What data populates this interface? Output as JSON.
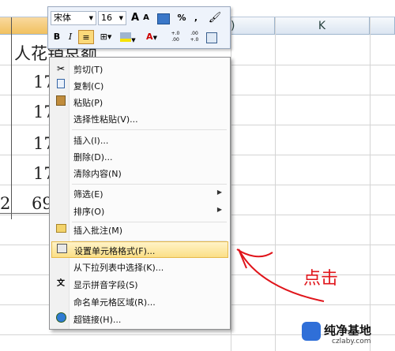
{
  "sheet": {
    "col_header_k": "K",
    "col_header_j_fragment": ")",
    "header_text": "人花销总额",
    "values": [
      "17",
      "17",
      "17",
      "17",
      "69"
    ],
    "row_fragment": "2"
  },
  "mini_toolbar": {
    "font_name": "宋体",
    "font_size": "16",
    "grow_font": "A",
    "shrink_font": "A",
    "percent": "%",
    "comma": ",",
    "bold": "B",
    "italic": "I",
    "font_color_letter": "A",
    "inc_decimal": "+.0 .00",
    "dec_decimal": ".00 +.0"
  },
  "context_menu": {
    "items": [
      {
        "label": "剪切(T)",
        "icon": "scissors-icon"
      },
      {
        "label": "复制(C)",
        "icon": "copy-icon"
      },
      {
        "label": "粘贴(P)",
        "icon": "paste-icon"
      },
      {
        "label": "选择性粘贴(V)...",
        "icon": ""
      },
      {
        "label": "插入(I)...",
        "icon": ""
      },
      {
        "label": "删除(D)...",
        "icon": ""
      },
      {
        "label": "清除内容(N)",
        "icon": ""
      },
      {
        "label": "筛选(E)",
        "icon": "",
        "submenu": true
      },
      {
        "label": "排序(O)",
        "icon": "",
        "submenu": true
      },
      {
        "label": "插入批注(M)",
        "icon": "comment-icon"
      },
      {
        "label": "设置单元格格式(F)...",
        "icon": "format-cells-icon",
        "highlighted": true
      },
      {
        "label": "从下拉列表中选择(K)...",
        "icon": ""
      },
      {
        "label": "显示拼音字段(S)",
        "icon": "phonetic-icon"
      },
      {
        "label": "命名单元格区域(R)...",
        "icon": ""
      },
      {
        "label": "超链接(H)...",
        "icon": "hyperlink-icon"
      }
    ]
  },
  "annotation": {
    "text": "点击",
    "color": "#e0151b"
  },
  "watermark": {
    "title": "纯净基地",
    "url": "czlaby.com"
  }
}
